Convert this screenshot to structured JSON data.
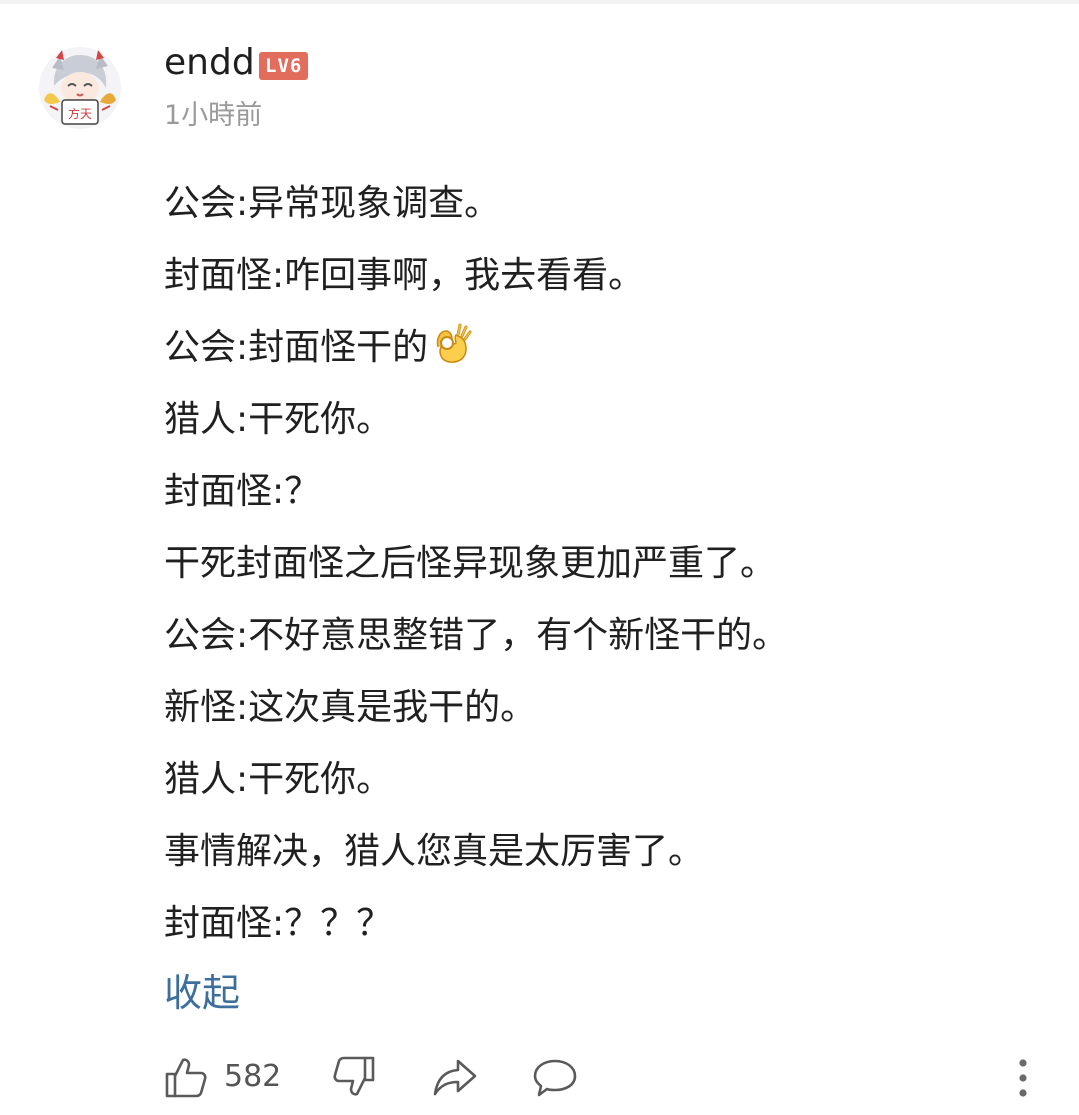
{
  "comment": {
    "author": "endd",
    "level_badge": "LV6",
    "timestamp": "1小時前",
    "avatar_caption": "方天",
    "lines": [
      "公会:异常现象调查。",
      "封面怪:咋回事啊，我去看看。",
      "公会:封面怪干的",
      "猎人:干死你。",
      "封面怪:？",
      "干死封面怪之后怪异现象更加严重了。",
      "公会:不好意思整错了，有个新怪干的。",
      "新怪:这次真是我干的。",
      "猎人:干死你。",
      "事情解决，猎人您真是太厉害了。",
      "封面怪:？？？"
    ],
    "emoji_after_line_3": "ok-hand-emoji",
    "collapse_label": "收起",
    "like_count": "582"
  },
  "icons": {
    "like": "thumbs-up-icon",
    "dislike": "thumbs-down-icon",
    "share": "share-arrow-icon",
    "reply": "speech-bubble-icon",
    "more": "vertical-ellipsis-icon"
  },
  "colors": {
    "text": "#202020",
    "meta": "#9a9a9a",
    "link": "#3d6f9e",
    "badge": "#e26d5c",
    "icon": "#5a5a5a"
  }
}
